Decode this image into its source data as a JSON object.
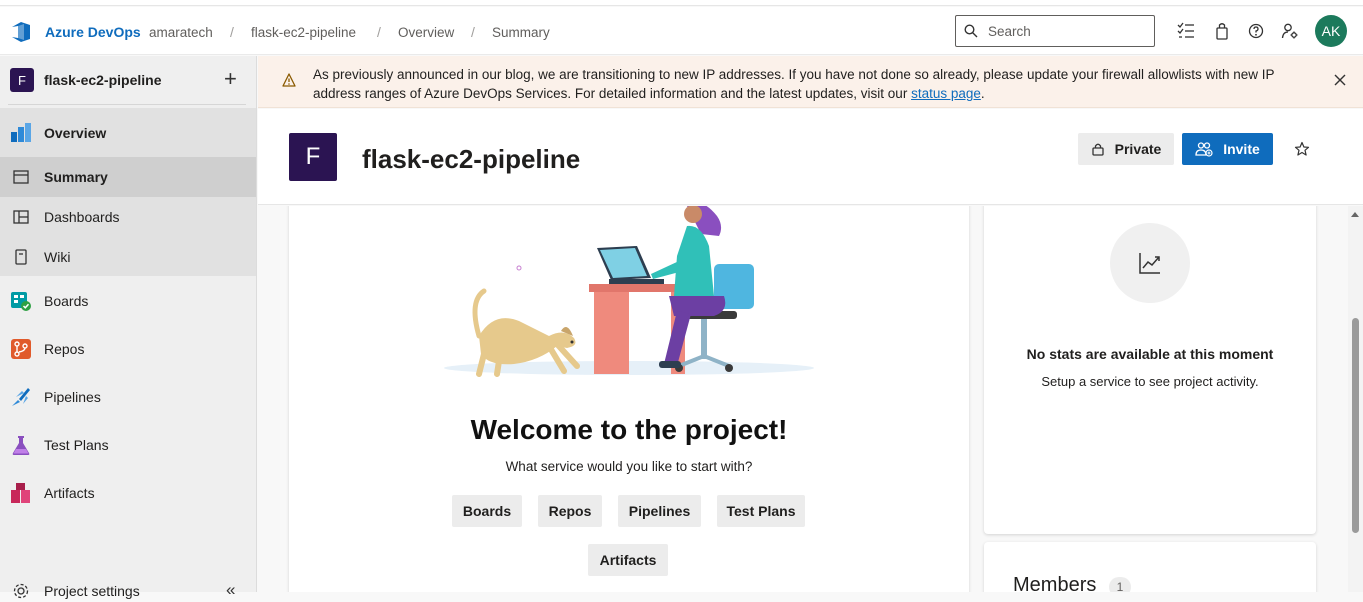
{
  "topbar": {
    "brand": "Azure DevOps",
    "breadcrumbs": [
      "amaratech",
      "flask-ec2-pipeline",
      "Overview",
      "Summary"
    ],
    "separator": "/",
    "search_placeholder": "Search",
    "avatar_initials": "AK"
  },
  "sidebar": {
    "project_initial": "F",
    "project_name": "flask-ec2-pipeline",
    "add_symbol": "+",
    "items": [
      {
        "label": "Overview",
        "icon": "overview-icon"
      },
      {
        "label": "Summary",
        "icon": "summary-icon"
      },
      {
        "label": "Dashboards",
        "icon": "dashboards-icon"
      },
      {
        "label": "Wiki",
        "icon": "wiki-icon"
      },
      {
        "label": "Boards",
        "icon": "boards-icon"
      },
      {
        "label": "Repos",
        "icon": "repos-icon"
      },
      {
        "label": "Pipelines",
        "icon": "pipelines-icon"
      },
      {
        "label": "Test Plans",
        "icon": "test-plans-icon"
      },
      {
        "label": "Artifacts",
        "icon": "artifacts-icon"
      }
    ],
    "settings_label": "Project settings",
    "collapse_symbol": "«"
  },
  "banner": {
    "text": "As previously announced in our blog, we are transitioning to new IP addresses. If you have not done so already, please update your firewall allowlists with new IP address ranges of Azure DevOps Services. For detailed information and the latest updates, visit our ",
    "link_text": "status page",
    "trailing": "."
  },
  "header": {
    "project_initial": "F",
    "title": "flask-ec2-pipeline",
    "private_label": "Private",
    "invite_label": "Invite"
  },
  "welcome": {
    "heading": "Welcome to the project!",
    "question": "What service would you like to start with?",
    "services": [
      "Boards",
      "Repos",
      "Pipelines",
      "Test Plans",
      "Artifacts"
    ]
  },
  "stats": {
    "heading": "No stats are available at this moment",
    "subtext": "Setup a service to see project activity."
  },
  "members": {
    "title": "Members",
    "count": "1"
  },
  "colors": {
    "accent": "#0f6cbd",
    "project_badge": "#2b1452",
    "avatar": "#1c7a5c",
    "banner_bg": "#fbf1ea"
  }
}
